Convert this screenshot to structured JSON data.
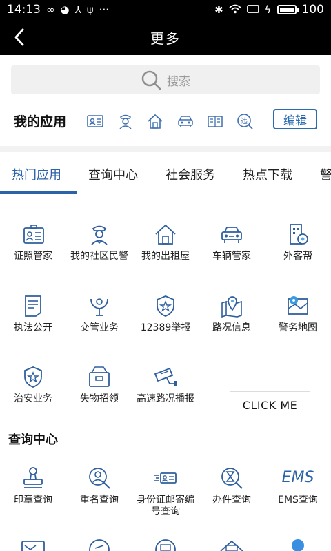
{
  "status_bar": {
    "time": "14:13",
    "left_icons": [
      "infinity-icon",
      "wechat-icon",
      "usb-icon",
      "trident-icon",
      "more-icon"
    ],
    "more": "···",
    "battery": "100"
  },
  "header": {
    "title": "更多"
  },
  "search": {
    "placeholder": "搜索"
  },
  "my_apps": {
    "label": "我的应用",
    "edit_label": "编辑"
  },
  "tabs": [
    {
      "label": "热门应用",
      "active": true
    },
    {
      "label": "查询中心",
      "active": false
    },
    {
      "label": "社会服务",
      "active": false
    },
    {
      "label": "热点下载",
      "active": false
    },
    {
      "label": "警",
      "active": false
    }
  ],
  "hot_apps": [
    {
      "label": "证照管家",
      "icon": "id-card-icon"
    },
    {
      "label": "我的社区民警",
      "icon": "police-officer-icon"
    },
    {
      "label": "我的出租屋",
      "icon": "house-icon"
    },
    {
      "label": "车辆管家",
      "icon": "car-icon"
    },
    {
      "label": "外客帮",
      "icon": "building-icon"
    },
    {
      "label": "执法公开",
      "icon": "document-icon"
    },
    {
      "label": "交管业务",
      "icon": "traffic-hand-icon"
    },
    {
      "label": "12389举报",
      "icon": "badge-star-icon"
    },
    {
      "label": "路况信息",
      "icon": "map-pin-icon"
    },
    {
      "label": "警务地图",
      "icon": "police-map-icon"
    },
    {
      "label": "治安业务",
      "icon": "shield-star-icon"
    },
    {
      "label": "失物招领",
      "icon": "box-icon"
    },
    {
      "label": "高速路况播报",
      "icon": "camera-icon"
    }
  ],
  "click_me": "CLICK ME",
  "query_center": {
    "title": "查询中心",
    "items": [
      {
        "label": "印章查询",
        "icon": "stamp-icon"
      },
      {
        "label": "重名查询",
        "icon": "person-search-icon"
      },
      {
        "label": "身份证邮寄编号查询",
        "icon": "id-mail-icon"
      },
      {
        "label": "办件查询",
        "icon": "hourglass-search-icon"
      },
      {
        "label": "EMS查询",
        "icon": "ems-icon",
        "icon_text": "EMS"
      }
    ]
  },
  "colors": {
    "accent": "#2a63a8",
    "icon_stroke": "#2f5f9e",
    "bar_bg": "#000000"
  }
}
